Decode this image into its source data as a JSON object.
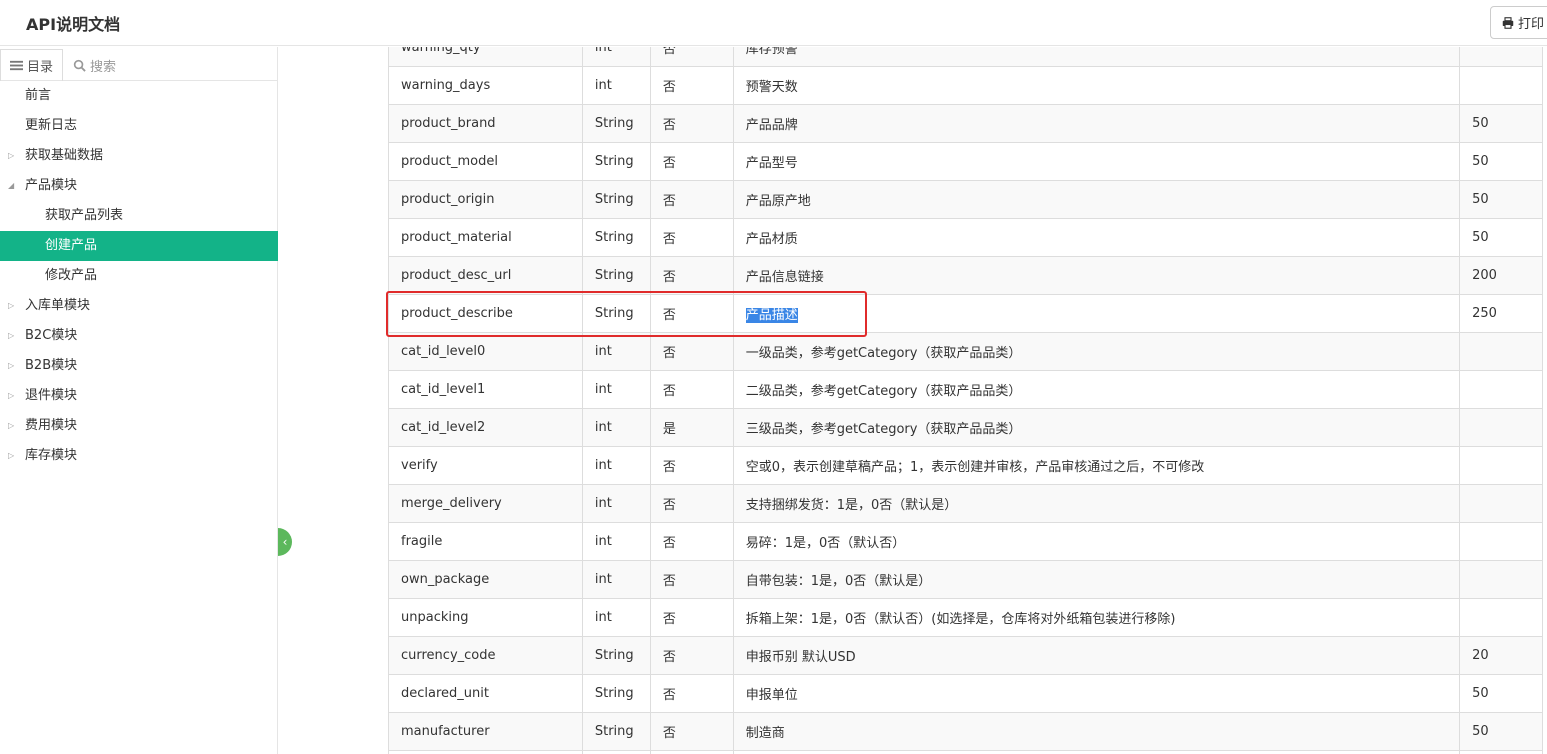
{
  "header": {
    "title": "API说明文档",
    "print_label": "打印"
  },
  "sidebar": {
    "toc_tab": "目录",
    "search_placeholder": "搜索",
    "items": [
      {
        "label": "前言",
        "level": 1,
        "expandable": false
      },
      {
        "label": "更新日志",
        "level": 1,
        "expandable": false
      },
      {
        "label": "获取基础数据",
        "level": 1,
        "expandable": true,
        "expanded": false
      },
      {
        "label": "产品模块",
        "level": 1,
        "expandable": true,
        "expanded": true
      },
      {
        "label": "获取产品列表",
        "level": 2,
        "expandable": false
      },
      {
        "label": "创建产品",
        "level": 2,
        "expandable": false,
        "active": true
      },
      {
        "label": "修改产品",
        "level": 2,
        "expandable": false
      },
      {
        "label": "入库单模块",
        "level": 1,
        "expandable": true,
        "expanded": false
      },
      {
        "label": "B2C模块",
        "level": 1,
        "expandable": true,
        "expanded": false
      },
      {
        "label": "B2B模块",
        "level": 1,
        "expandable": true,
        "expanded": false
      },
      {
        "label": "退件模块",
        "level": 1,
        "expandable": true,
        "expanded": false
      },
      {
        "label": "费用模块",
        "level": 1,
        "expandable": true,
        "expanded": false
      },
      {
        "label": "库存模块",
        "level": 1,
        "expandable": true,
        "expanded": false
      }
    ]
  },
  "colors": {
    "active_bg": "#13b388",
    "highlight_border": "#e02b2b",
    "selection_bg": "#3a86e6",
    "handle": "#5cb85c"
  },
  "table": {
    "rows": [
      [
        "warning_qty",
        "int",
        "否",
        "库存预警",
        ""
      ],
      [
        "warning_days",
        "int",
        "否",
        "预警天数",
        ""
      ],
      [
        "product_brand",
        "String",
        "否",
        "产品品牌",
        "50"
      ],
      [
        "product_model",
        "String",
        "否",
        "产品型号",
        "50"
      ],
      [
        "product_origin",
        "String",
        "否",
        "产品原产地",
        "50"
      ],
      [
        "product_material",
        "String",
        "否",
        "产品材质",
        "50"
      ],
      [
        "product_desc_url",
        "String",
        "否",
        "产品信息链接",
        "200"
      ],
      [
        "product_describe",
        "String",
        "否",
        "产品描述",
        "250"
      ],
      [
        "cat_id_level0",
        "int",
        "否",
        "一级品类，参考getCategory（获取产品品类）",
        ""
      ],
      [
        "cat_id_level1",
        "int",
        "否",
        "二级品类，参考getCategory（获取产品品类）",
        ""
      ],
      [
        "cat_id_level2",
        "int",
        "是",
        "三级品类，参考getCategory（获取产品品类）",
        ""
      ],
      [
        "verify",
        "int",
        "否",
        "空或0，表示创建草稿产品；1，表示创建并审核，产品审核通过之后，不可修改",
        ""
      ],
      [
        "merge_delivery",
        "int",
        "否",
        "支持捆绑发货：1是，0否（默认是）",
        ""
      ],
      [
        "fragile",
        "int",
        "否",
        "易碎：1是，0否（默认否）",
        ""
      ],
      [
        "own_package",
        "int",
        "否",
        "自带包装：1是，0否（默认是）",
        ""
      ],
      [
        "unpacking",
        "int",
        "否",
        "拆箱上架：1是，0否（默认否）(如选择是，仓库将对外纸箱包装进行移除)",
        ""
      ],
      [
        "currency_code",
        "String",
        "否",
        "申报币别 默认USD",
        "20"
      ],
      [
        "declared_unit",
        "String",
        "否",
        "申报单位",
        "50"
      ],
      [
        "manufacturer",
        "String",
        "否",
        "制造商",
        "50"
      ],
      [
        "",
        "",
        "",
        "",
        ""
      ]
    ],
    "highlighted_row": 7
  }
}
